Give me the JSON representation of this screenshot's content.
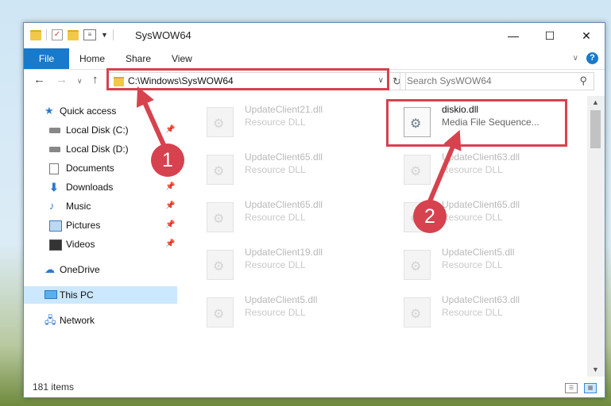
{
  "window": {
    "title": "SysWOW64",
    "minimize_glyph": "—",
    "maximize_glyph": "☐",
    "close_glyph": "✕"
  },
  "ribbon": {
    "tabs": [
      {
        "label": "File",
        "active": true
      },
      {
        "label": "Home"
      },
      {
        "label": "Share"
      },
      {
        "label": "View"
      }
    ],
    "help_glyph": "?",
    "collapse_glyph": "∨"
  },
  "address": {
    "path": "C:\\Windows\\SysWOW64",
    "search_placeholder": "Search SysWOW64"
  },
  "nav": {
    "quick_access": "Quick access",
    "items": [
      {
        "label": "Local Disk (C:)",
        "pinned": true
      },
      {
        "label": "Local Disk (D:)"
      },
      {
        "label": "Documents"
      },
      {
        "label": "Downloads",
        "pinned": true
      },
      {
        "label": "Music",
        "pinned": true
      },
      {
        "label": "Pictures",
        "pinned": true
      },
      {
        "label": "Videos",
        "pinned": true
      }
    ],
    "onedrive": "OneDrive",
    "this_pc": "This PC",
    "network": "Network"
  },
  "files": [
    {
      "name": "UpdateClient21.dll",
      "type": "Resource DLL"
    },
    {
      "name": "diskio.dll",
      "type": "Media File Sequence...",
      "highlighted": true
    },
    {
      "name": "UpdateClient65.dll",
      "type": "Resource DLL"
    },
    {
      "name": "UpdateClient63.dll",
      "type": "Resource DLL"
    },
    {
      "name": "UpdateClient65.dll",
      "type": "Resource DLL"
    },
    {
      "name": "UpdateClient65.dll",
      "type": "Resource DLL"
    },
    {
      "name": "UpdateClient19.dll",
      "type": "Resource DLL"
    },
    {
      "name": "UpdateClient5.dll",
      "type": "Resource DLL"
    },
    {
      "name": "UpdateClient5.dll",
      "type": "Resource DLL"
    },
    {
      "name": "UpdateClient63.dll",
      "type": "Resource DLL"
    }
  ],
  "status": {
    "item_count": "181 items"
  },
  "annotations": {
    "step1": "1",
    "step2": "2",
    "color": "#d6424e"
  }
}
